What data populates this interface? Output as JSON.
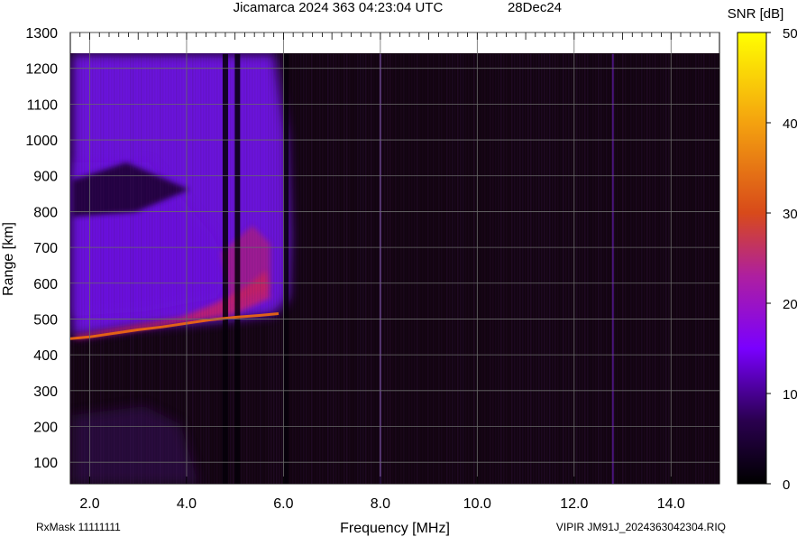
{
  "header": {
    "title": "Jicamarca 2024 363 04:23:04 UTC",
    "date": "28Dec24"
  },
  "colorbar": {
    "label": "SNR [dB]",
    "ticks": [
      "50",
      "40",
      "30",
      "20",
      "10",
      "0"
    ],
    "range": [
      0,
      50
    ],
    "colors": [
      "#000000",
      "#2a004f",
      "#7a00ff",
      "#ae1fa0",
      "#d84a1a",
      "#f4a20f",
      "#ffff00"
    ]
  },
  "footer": {
    "rxmask": "RxMask 11111111",
    "file": "VIPIR  JM91J_2024363042304.RIQ"
  },
  "chart_data": {
    "type": "heatmap",
    "title": "Jicamarca 2024 363 04:23:04 UTC",
    "subtitle": "28Dec24",
    "xlabel": "Frequency [MHz]",
    "ylabel": "Range [km]",
    "xlim": [
      1.6,
      15.0
    ],
    "ylim": [
      40,
      1300
    ],
    "data_top_km": 1240,
    "xticks": [
      "2.0",
      "4.0",
      "6.0",
      "8.0",
      "10.0",
      "12.0",
      "14.0"
    ],
    "yticks": [
      "100",
      "200",
      "300",
      "400",
      "500",
      "600",
      "700",
      "800",
      "900",
      "1000",
      "1100",
      "1200",
      "1300"
    ],
    "colorbar_label": "SNR [dB]",
    "zlim": [
      0,
      50
    ],
    "grid": true,
    "trace_F_layer": {
      "frequency_mhz": [
        1.6,
        2.0,
        2.5,
        3.0,
        3.5,
        4.0,
        4.5,
        5.0,
        5.5,
        5.9
      ],
      "virtual_height_km": [
        445,
        450,
        460,
        470,
        478,
        488,
        498,
        505,
        510,
        515
      ]
    },
    "vertical_interference_mhz": [
      4.8,
      5.05,
      6.05,
      8.0,
      12.8
    ]
  }
}
